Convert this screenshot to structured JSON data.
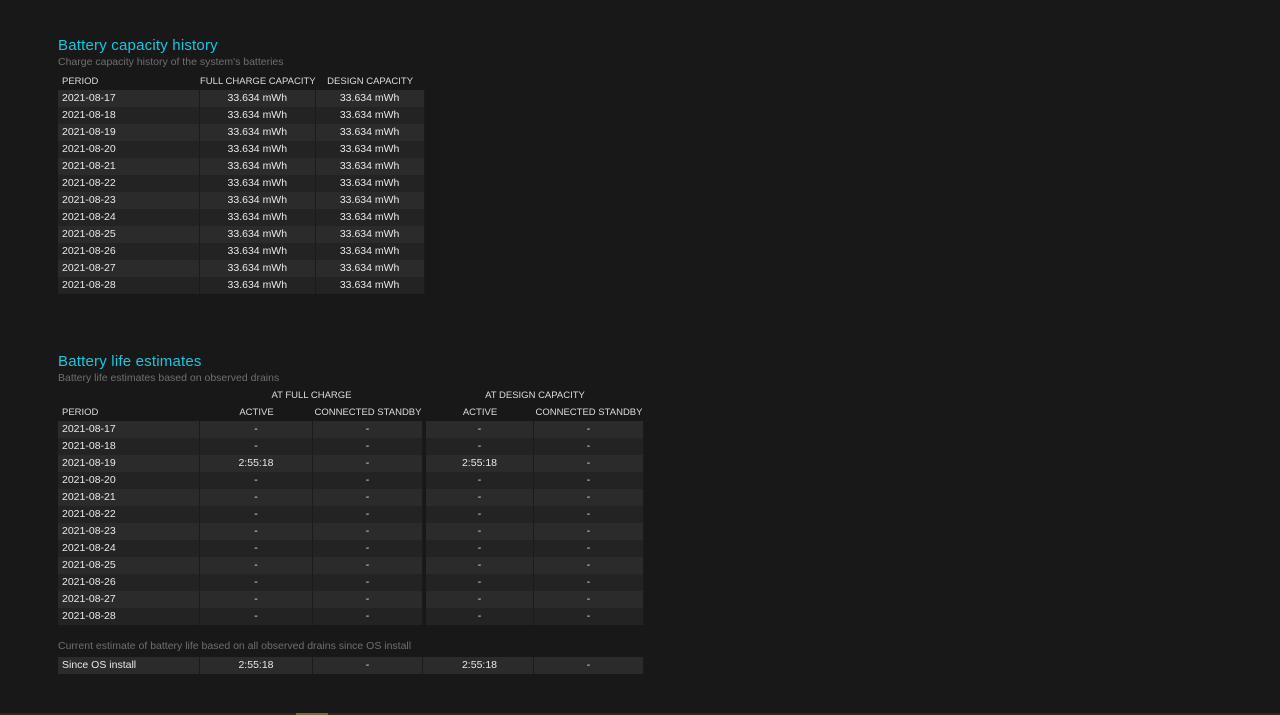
{
  "capacity": {
    "title": "Battery capacity history",
    "subtitle": "Charge capacity history of the system's batteries",
    "headers": {
      "period": "PERIOD",
      "full": "FULL CHARGE CAPACITY",
      "design": "DESIGN CAPACITY"
    },
    "rows": [
      {
        "period": "2021-08-17",
        "full": "33.634 mWh",
        "design": "33.634 mWh"
      },
      {
        "period": "2021-08-18",
        "full": "33.634 mWh",
        "design": "33.634 mWh"
      },
      {
        "period": "2021-08-19",
        "full": "33.634 mWh",
        "design": "33.634 mWh"
      },
      {
        "period": "2021-08-20",
        "full": "33.634 mWh",
        "design": "33.634 mWh"
      },
      {
        "period": "2021-08-21",
        "full": "33.634 mWh",
        "design": "33.634 mWh"
      },
      {
        "period": "2021-08-22",
        "full": "33.634 mWh",
        "design": "33.634 mWh"
      },
      {
        "period": "2021-08-23",
        "full": "33.634 mWh",
        "design": "33.634 mWh"
      },
      {
        "period": "2021-08-24",
        "full": "33.634 mWh",
        "design": "33.634 mWh"
      },
      {
        "period": "2021-08-25",
        "full": "33.634 mWh",
        "design": "33.634 mWh"
      },
      {
        "period": "2021-08-26",
        "full": "33.634 mWh",
        "design": "33.634 mWh"
      },
      {
        "period": "2021-08-27",
        "full": "33.634 mWh",
        "design": "33.634 mWh"
      },
      {
        "period": "2021-08-28",
        "full": "33.634 mWh",
        "design": "33.634 mWh"
      }
    ]
  },
  "life": {
    "title": "Battery life estimates",
    "subtitle": "Battery life estimates based on observed drains",
    "group_full": "AT FULL CHARGE",
    "group_design": "AT DESIGN CAPACITY",
    "headers": {
      "period": "PERIOD",
      "active": "ACTIVE",
      "standby": "CONNECTED STANDBY"
    },
    "rows": [
      {
        "period": "2021-08-17",
        "full_active": "-",
        "full_standby": "-",
        "design_active": "-",
        "design_standby": "-"
      },
      {
        "period": "2021-08-18",
        "full_active": "-",
        "full_standby": "-",
        "design_active": "-",
        "design_standby": "-"
      },
      {
        "period": "2021-08-19",
        "full_active": "2:55:18",
        "full_standby": "-",
        "design_active": "2:55:18",
        "design_standby": "-"
      },
      {
        "period": "2021-08-20",
        "full_active": "-",
        "full_standby": "-",
        "design_active": "-",
        "design_standby": "-"
      },
      {
        "period": "2021-08-21",
        "full_active": "-",
        "full_standby": "-",
        "design_active": "-",
        "design_standby": "-"
      },
      {
        "period": "2021-08-22",
        "full_active": "-",
        "full_standby": "-",
        "design_active": "-",
        "design_standby": "-"
      },
      {
        "period": "2021-08-23",
        "full_active": "-",
        "full_standby": "-",
        "design_active": "-",
        "design_standby": "-"
      },
      {
        "period": "2021-08-24",
        "full_active": "-",
        "full_standby": "-",
        "design_active": "-",
        "design_standby": "-"
      },
      {
        "period": "2021-08-25",
        "full_active": "-",
        "full_standby": "-",
        "design_active": "-",
        "design_standby": "-"
      },
      {
        "period": "2021-08-26",
        "full_active": "-",
        "full_standby": "-",
        "design_active": "-",
        "design_standby": "-"
      },
      {
        "period": "2021-08-27",
        "full_active": "-",
        "full_standby": "-",
        "design_active": "-",
        "design_standby": "-"
      },
      {
        "period": "2021-08-28",
        "full_active": "-",
        "full_standby": "-",
        "design_active": "-",
        "design_standby": "-"
      }
    ],
    "note": "Current estimate of battery life based on all observed drains since OS install",
    "since": {
      "period": "Since OS install",
      "full_active": "2:55:18",
      "full_standby": "-",
      "design_active": "2:55:18",
      "design_standby": "-"
    }
  },
  "colors": {
    "accent": "#16c7de",
    "background": "#181818"
  }
}
